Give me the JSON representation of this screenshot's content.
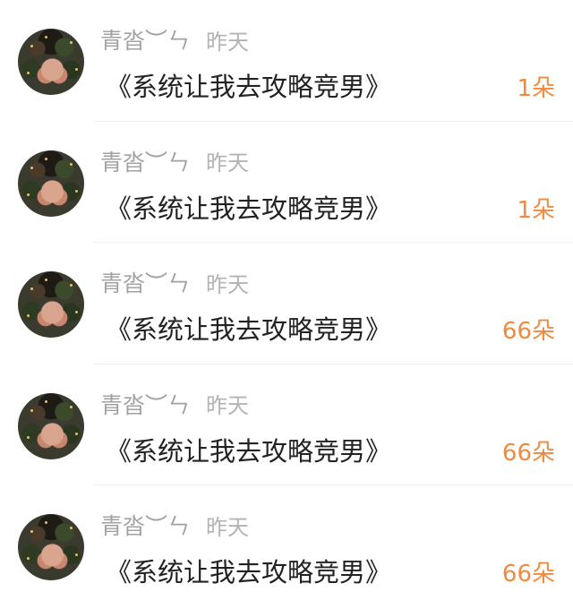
{
  "records": [
    {
      "username": "青沓︶ㄣ",
      "time": "昨天",
      "title": "《系统让我去攻略竞男》",
      "count": "1朵"
    },
    {
      "username": "青沓︶ㄣ",
      "time": "昨天",
      "title": "《系统让我去攻略竞男》",
      "count": "1朵"
    },
    {
      "username": "青沓︶ㄣ",
      "time": "昨天",
      "title": "《系统让我去攻略竞男》",
      "count": "66朵"
    },
    {
      "username": "青沓︶ㄣ",
      "time": "昨天",
      "title": "《系统让我去攻略竞男》",
      "count": "66朵"
    },
    {
      "username": "青沓︶ㄣ",
      "time": "昨天",
      "title": "《系统让我去攻略竞男》",
      "count": "66朵"
    }
  ],
  "colors": {
    "accent": "#f08a3e",
    "muted": "#a8a8a8",
    "text": "#222222",
    "divider": "#eeeeee"
  }
}
